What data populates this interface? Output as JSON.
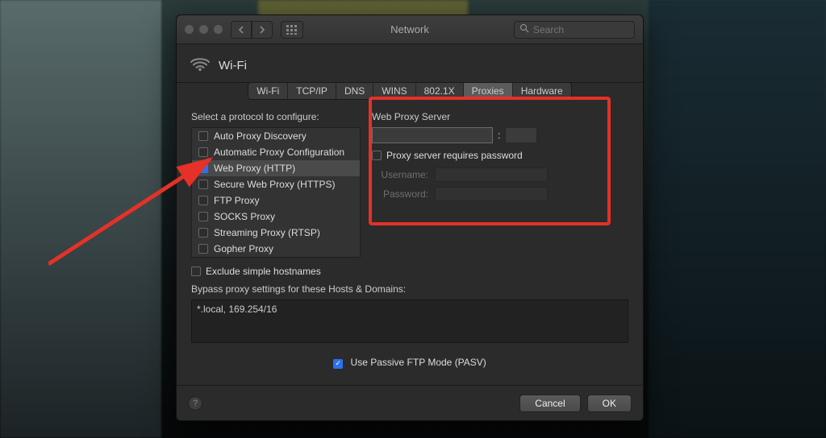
{
  "window": {
    "title": "Network"
  },
  "search": {
    "placeholder": "Search"
  },
  "connection": {
    "name": "Wi-Fi"
  },
  "tabs": {
    "wifi": "Wi-Fi",
    "tcpip": "TCP/IP",
    "dns": "DNS",
    "wins": "WINS",
    "8021x": "802.1X",
    "proxies": "Proxies",
    "hardware": "Hardware"
  },
  "labels": {
    "select_protocol": "Select a protocol to configure:",
    "web_proxy_server": "Web Proxy Server",
    "requires_password": "Proxy server requires password",
    "username": "Username:",
    "password": "Password:",
    "exclude_simple": "Exclude simple hostnames",
    "bypass_label": "Bypass proxy settings for these Hosts & Domains:",
    "pasv": "Use Passive FTP Mode (PASV)",
    "colon": ":"
  },
  "protocols": [
    {
      "label": "Auto Proxy Discovery",
      "checked": false
    },
    {
      "label": "Automatic Proxy Configuration",
      "checked": false
    },
    {
      "label": "Web Proxy (HTTP)",
      "checked": true
    },
    {
      "label": "Secure Web Proxy (HTTPS)",
      "checked": false
    },
    {
      "label": "FTP Proxy",
      "checked": false
    },
    {
      "label": "SOCKS Proxy",
      "checked": false
    },
    {
      "label": "Streaming Proxy (RTSP)",
      "checked": false
    },
    {
      "label": "Gopher Proxy",
      "checked": false
    }
  ],
  "proxy": {
    "server": "",
    "port": "",
    "username": "",
    "password": ""
  },
  "bypass": {
    "value": "*.local, 169.254/16"
  },
  "pasv_checked": true,
  "buttons": {
    "cancel": "Cancel",
    "ok": "OK"
  }
}
